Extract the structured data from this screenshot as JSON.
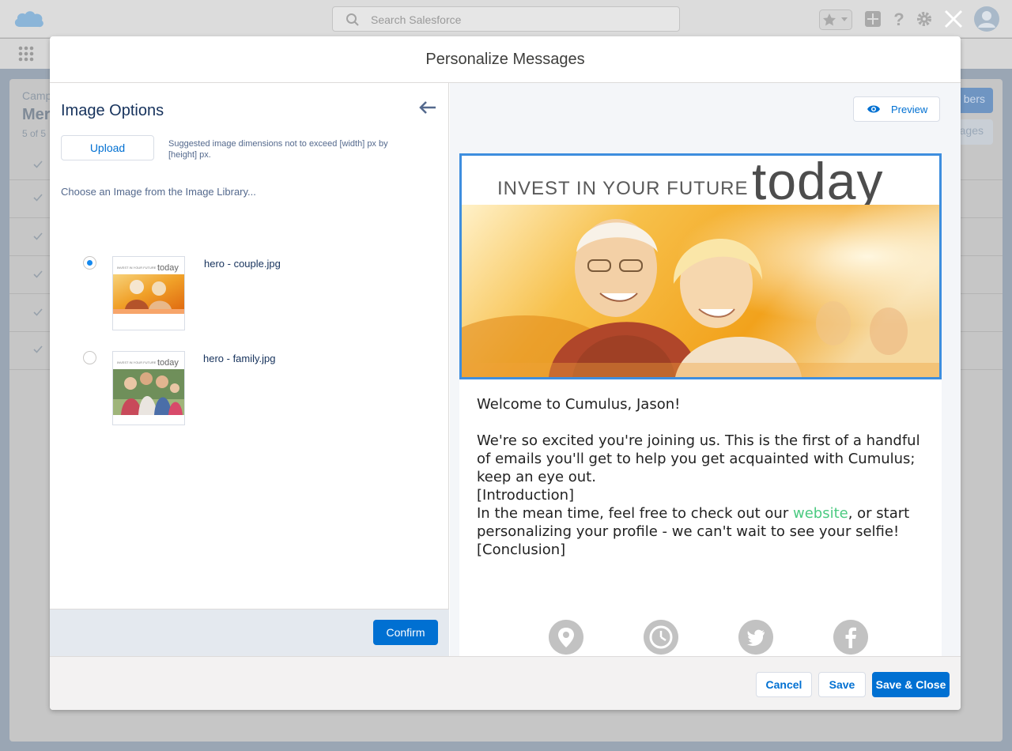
{
  "app": {
    "search_placeholder": "Search Salesforce",
    "bg_breadcrumb": "Camp",
    "bg_title": "Mer",
    "bg_count": "5 of 5",
    "bg_btn1": "bers",
    "bg_btn2": "ages"
  },
  "modal": {
    "title": "Personalize Messages"
  },
  "image_options": {
    "title": "Image Options",
    "upload_label": "Upload",
    "upload_hint": "Suggested image dimensions not to exceed [width] px by [height] px.",
    "library_label": "Choose an Image from the Image Library...",
    "thumb_caption_small": "INVEST IN YOUR FUTURE",
    "thumb_caption_big": "today",
    "images": [
      {
        "name": "hero - couple.jpg",
        "selected": true
      },
      {
        "name": "hero - family.jpg",
        "selected": false
      }
    ],
    "confirm_label": "Confirm"
  },
  "preview": {
    "button_label": "Preview",
    "hero_small": "INVEST IN YOUR FUTURE",
    "hero_big": "today",
    "greeting": "Welcome to Cumulus, Jason!",
    "paragraph": "We're so excited you're joining us. This is the first of a handful of emails you'll get to help you get acquainted with Cumulus; keep an eye out.",
    "introduction": "[Introduction]",
    "line_before_link": "In the mean time, feel free to check out our ",
    "link_text": "website",
    "line_after_link": ", or start personalizing your profile - we can't wait to see your selfie!",
    "conclusion": "[Conclusion]",
    "social_icons": [
      "location-pin-icon",
      "clock-icon",
      "twitter-icon",
      "facebook-icon"
    ]
  },
  "footer": {
    "cancel_label": "Cancel",
    "save_label": "Save",
    "save_close_label": "Save & Close"
  },
  "colors": {
    "brand": "#0070d2",
    "link": "#4bca81",
    "radio_selected": "#1589ee",
    "hero_border": "#3e8ede"
  }
}
